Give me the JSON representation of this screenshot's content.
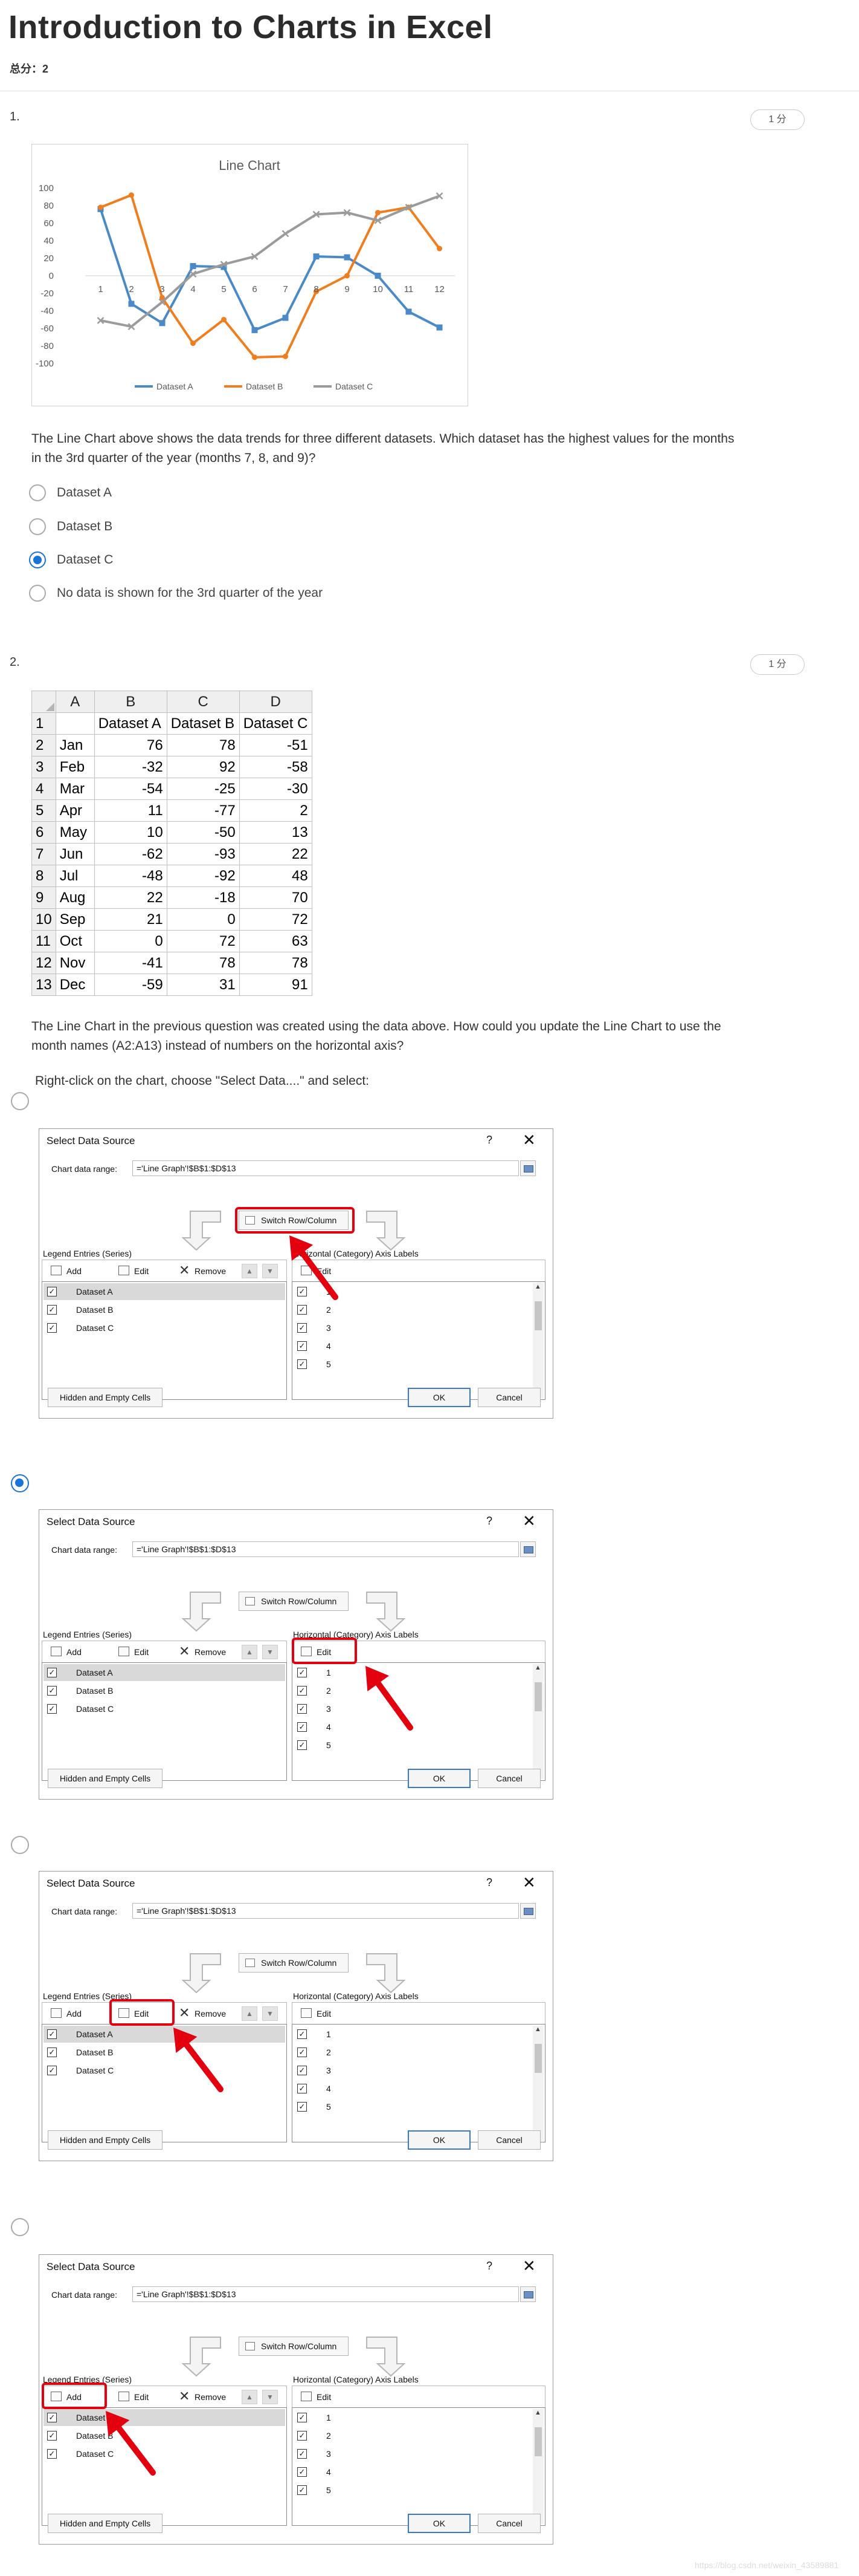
{
  "page": {
    "title": "Introduction to Charts in Excel",
    "score": "总分：2",
    "watermark": "https://blog.csdn.net/weixin_43589881"
  },
  "q1": {
    "number": "1.",
    "points": "1 分",
    "question": "The Line Chart above shows the data trends for three different datasets.  Which dataset has the highest values for the months in the 3rd quarter of the year (months 7, 8, and 9)?",
    "options": [
      "Dataset A",
      "Dataset B",
      "Dataset C",
      "No data is shown for the 3rd quarter of the year"
    ],
    "selected_index": 2
  },
  "chart_data": {
    "type": "line",
    "title": "Line Chart",
    "categories": [
      "1",
      "2",
      "3",
      "4",
      "5",
      "6",
      "7",
      "8",
      "9",
      "10",
      "11",
      "12"
    ],
    "ylim": [
      -100,
      100
    ],
    "yticks": [
      "100",
      "80",
      "60",
      "40",
      "20",
      "0",
      "-20",
      "-40",
      "-60",
      "-80",
      "-100"
    ],
    "grid": false,
    "legend_position": "bottom",
    "series": [
      {
        "name": "Dataset A",
        "color": "#4a8ac8",
        "marker": "square",
        "values": [
          76,
          -32,
          -54,
          11,
          10,
          -62,
          -48,
          22,
          21,
          0,
          -41,
          -59
        ]
      },
      {
        "name": "Dataset B",
        "color": "#f07d1e",
        "marker": "circle",
        "values": [
          78,
          92,
          -25,
          -77,
          -50,
          -93,
          -92,
          -18,
          0,
          72,
          78,
          31
        ]
      },
      {
        "name": "Dataset C",
        "color": "#9b9b9b",
        "marker": "x",
        "values": [
          -51,
          -58,
          -30,
          2,
          13,
          22,
          48,
          70,
          72,
          63,
          78,
          91
        ]
      }
    ]
  },
  "q2": {
    "number": "2.",
    "points": "1 分",
    "sheet": {
      "col_headers": [
        "A",
        "B",
        "C",
        "D"
      ],
      "header_row": [
        "",
        "Dataset A",
        "Dataset B",
        "Dataset C"
      ],
      "rows": [
        [
          "Jan",
          "76",
          "78",
          "-51"
        ],
        [
          "Feb",
          "-32",
          "92",
          "-58"
        ],
        [
          "Mar",
          "-54",
          "-25",
          "-30"
        ],
        [
          "Apr",
          "11",
          "-77",
          "2"
        ],
        [
          "May",
          "10",
          "-50",
          "13"
        ],
        [
          "Jun",
          "-62",
          "-93",
          "22"
        ],
        [
          "Jul",
          "-48",
          "-92",
          "48"
        ],
        [
          "Aug",
          "22",
          "-18",
          "70"
        ],
        [
          "Sep",
          "21",
          "0",
          "72"
        ],
        [
          "Oct",
          "0",
          "72",
          "63"
        ],
        [
          "Nov",
          "-41",
          "78",
          "78"
        ],
        [
          "Dec",
          "-59",
          "31",
          "91"
        ]
      ],
      "row_numbers": [
        "1",
        "2",
        "3",
        "4",
        "5",
        "6",
        "7",
        "8",
        "9",
        "10",
        "11",
        "12",
        "13"
      ]
    },
    "question": "The Line Chart in the previous question was created using the data above.  How could you update the Line Chart to use the month names (A2:A13) instead of numbers on the horizontal axis?",
    "instruction": "Right-click on the chart, choose \"Select Data....\" and select:",
    "selected_index": 1
  },
  "dialog": {
    "title": "Select Data Source",
    "help": "?",
    "close": "✕",
    "range_label": "Chart data range:",
    "range_value": "='Line Graph'!$B$1:$D$13",
    "switch_label": "Switch Row/Column",
    "legend_label": "Legend Entries (Series)",
    "axis_label": "Horizontal (Category) Axis Labels",
    "add": "Add",
    "edit": "Edit",
    "remove": "Remove",
    "up": "▲",
    "down": "▼",
    "series": [
      "Dataset A",
      "Dataset B",
      "Dataset C"
    ],
    "axis_items": [
      "1",
      "2",
      "3",
      "4",
      "5"
    ],
    "check": "✓",
    "hidden_empty": "Hidden and Empty Cells",
    "ok": "OK",
    "cancel": "Cancel"
  }
}
